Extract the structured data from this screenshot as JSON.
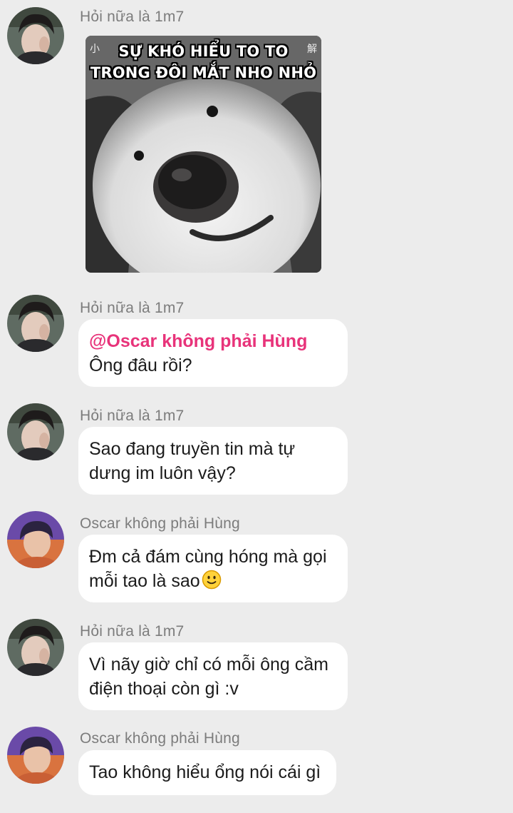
{
  "messages": [
    {
      "sender": "Hỏi nữa là 1m7",
      "type": "image",
      "meme": {
        "caption_line1": "SỰ KHÓ HIỂU TO TO",
        "caption_line2": "TRONG ĐÔI MẮT NHO NHỎ",
        "corner_left": "小",
        "corner_right": "解"
      }
    },
    {
      "sender": "Hỏi nữa là 1m7",
      "type": "text",
      "mention": "@Oscar không phải Hùng",
      "lines": [
        "Ông đâu rồi?"
      ]
    },
    {
      "sender": "Hỏi nữa là 1m7",
      "type": "text",
      "lines": [
        "Sao đang truyền tin mà tự",
        "dưng im luôn vậy?"
      ]
    },
    {
      "sender": "Oscar không phải Hùng",
      "type": "text",
      "lines": [
        "Đm cả đám cùng hóng mà gọi",
        "mỗi tao là sao"
      ],
      "emoji": "slightly-smiling-face"
    },
    {
      "sender": "Hỏi nữa là 1m7",
      "type": "text",
      "lines": [
        "Vì nãy giờ chỉ có mỗi ông cầm",
        "điện thoại còn gì :v"
      ]
    },
    {
      "sender": "Oscar không phải Hùng",
      "type": "text",
      "lines": [
        "Tao không hiểu ổng nói cái gì"
      ]
    }
  ],
  "colors": {
    "background": "#ececec",
    "bubble": "#ffffff",
    "mention": "#e8337a",
    "sender_name": "#7c7c7c"
  }
}
